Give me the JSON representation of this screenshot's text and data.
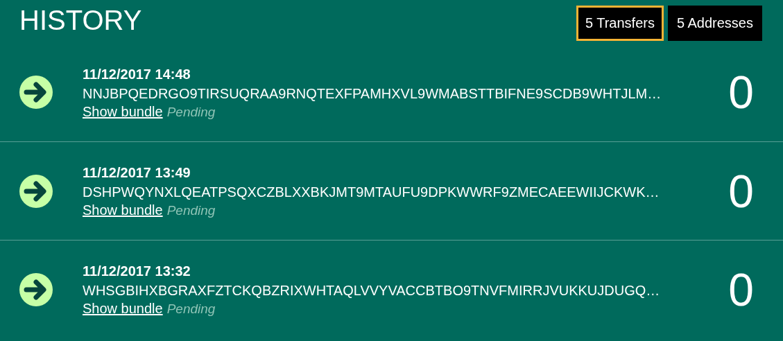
{
  "title": "HISTORY",
  "tabs": [
    {
      "label": "5 Transfers",
      "selected": true
    },
    {
      "label": "5 Addresses",
      "selected": false
    }
  ],
  "transfers": [
    {
      "date": "11/12/2017 14:48",
      "address": "NNJBPQEDRGO9TIRSUQRAA9RNQTEXFPAMHXVL9WMABSTTBIFNE9SCDB9WHTJLM…",
      "link": "Show bundle",
      "status": "Pending",
      "value": "0"
    },
    {
      "date": "11/12/2017 13:49",
      "address": "DSHPWQYNXLQEATPSQXCZBLXXBKJMT9MTAUFU9DPKWWRF9ZMECAEEWIIJCKWK…",
      "link": "Show bundle",
      "status": "Pending",
      "value": "0"
    },
    {
      "date": "11/12/2017 13:32",
      "address": "WHSGBIHXBGRAXFZTCKQBZRIXWHTAQLVVYVACCBTBO9TNVFMIRRJVUKKUJDUGQ…",
      "link": "Show bundle",
      "status": "Pending",
      "value": "0"
    }
  ]
}
